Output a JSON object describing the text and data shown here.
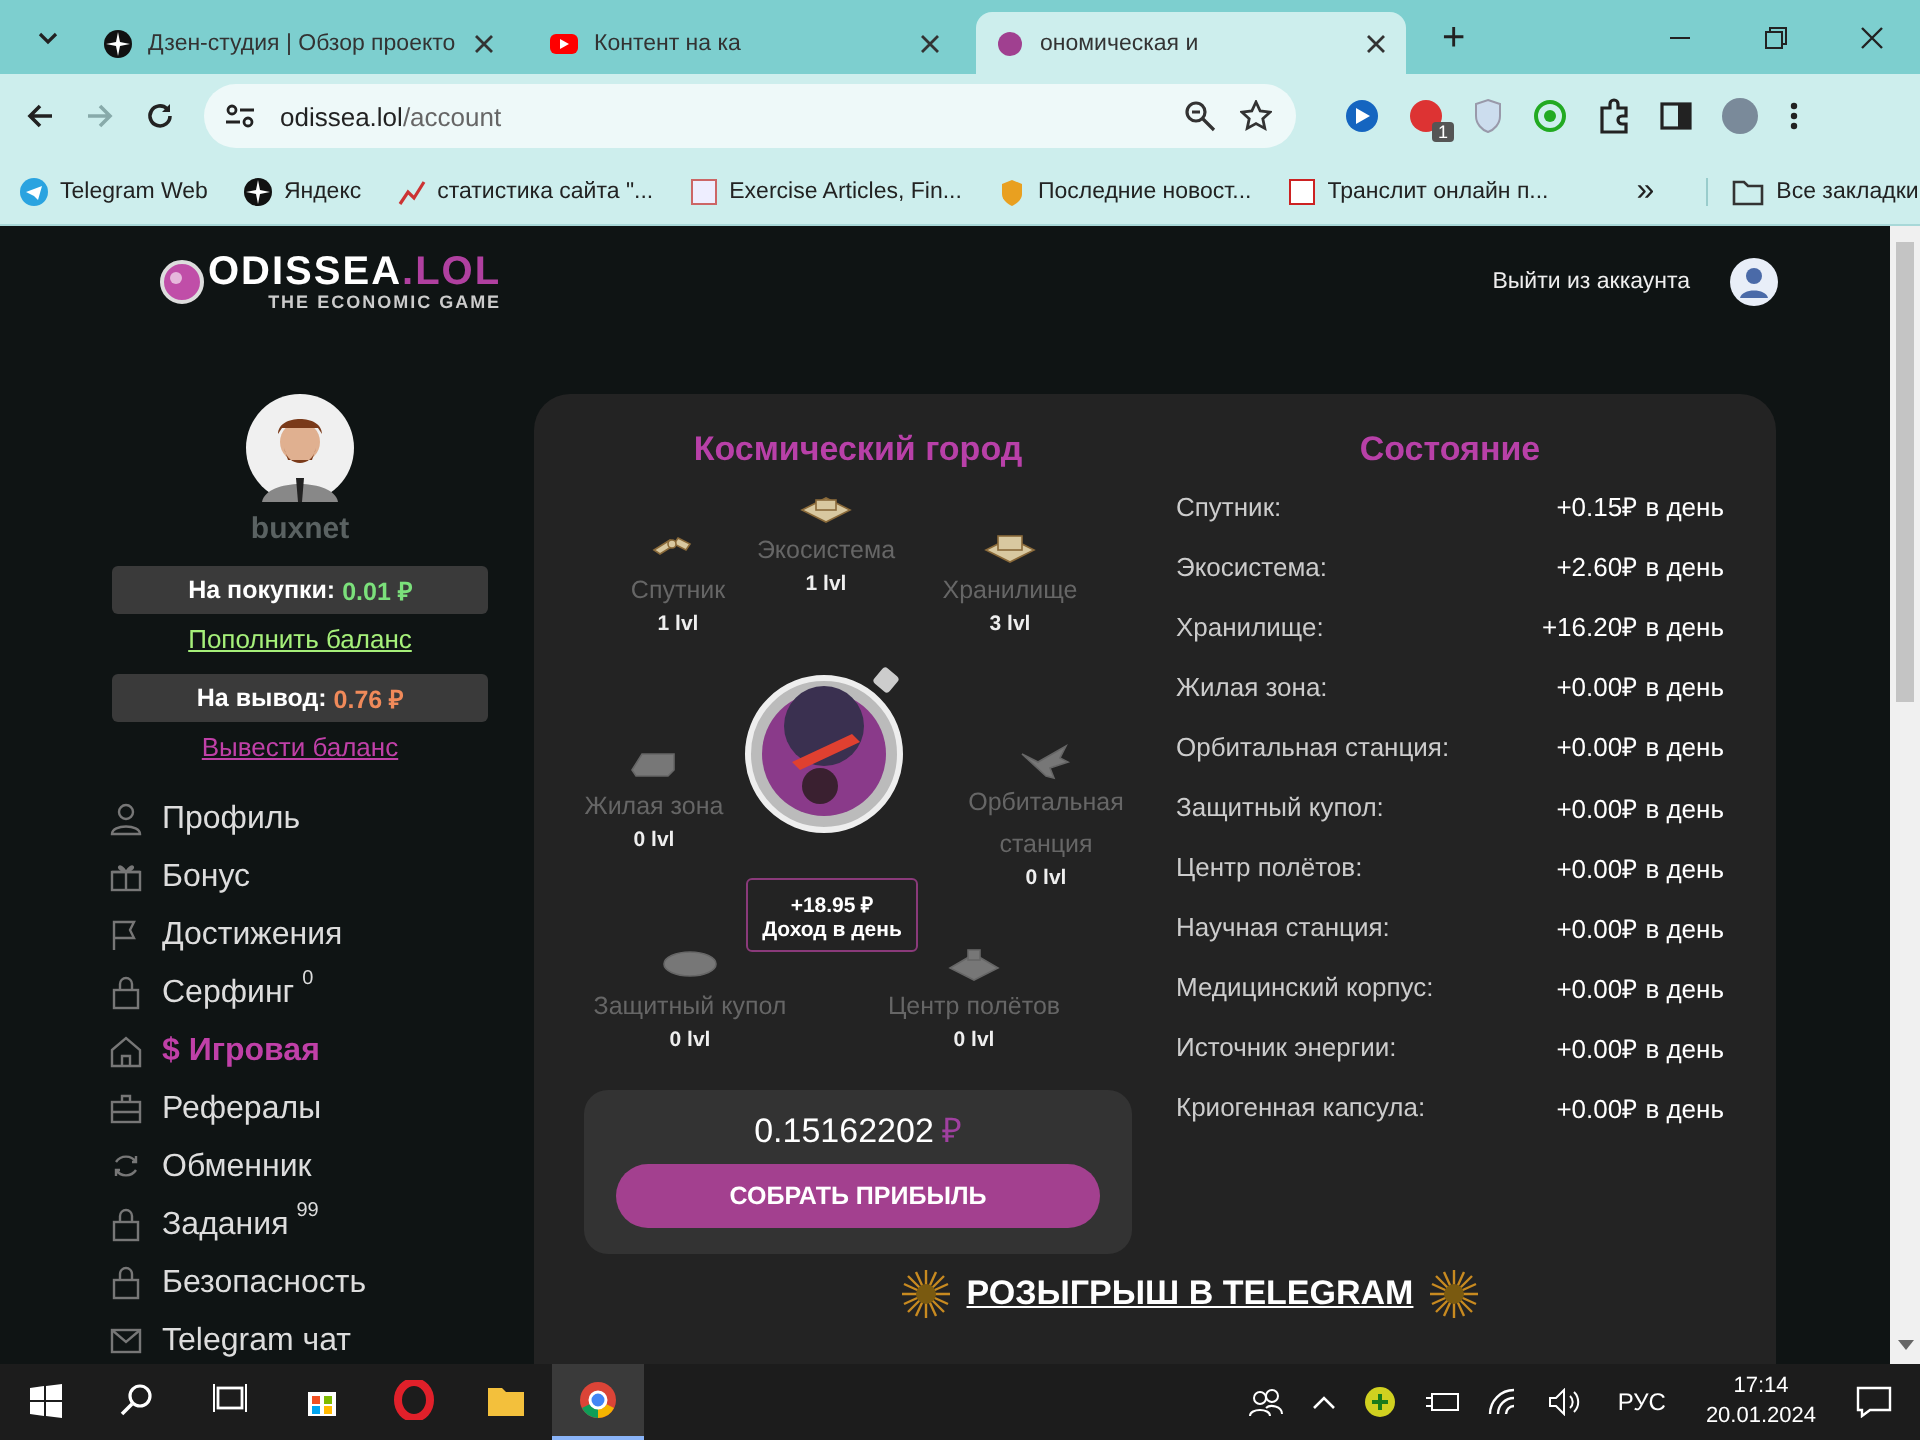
{
  "browser": {
    "tabs": [
      {
        "title": "Дзен-студия | Обзор проекто",
        "selected": false
      },
      {
        "title": "Контент на ка",
        "selected": false
      },
      {
        "title": "ономическая и",
        "selected": true
      }
    ],
    "new_tab": "+",
    "url": {
      "host": "odissea.lol",
      "path": "/account"
    },
    "extension_badge": "1",
    "bookmarks": [
      {
        "title": "Telegram Web"
      },
      {
        "title": "Яндекс"
      },
      {
        "title": "статистика сайта \"..."
      },
      {
        "title": "Exercise Articles, Fin..."
      },
      {
        "title": "Последние новост..."
      },
      {
        "title": "Транслит онлайн п..."
      }
    ],
    "more_bookmarks": "»",
    "all_bookmarks": "Все закладки"
  },
  "page": {
    "logo": {
      "name": "ODISSEA",
      "tld": ".LOL",
      "tagline": "THE ECONOMIC GAME"
    },
    "logout": "Выйти из аккаунта",
    "user": {
      "name": "buxnet"
    },
    "balances": [
      {
        "label": "На покупки:",
        "amount": "0.01 ₽",
        "color": "#7be07b",
        "link": "Пополнить баланс",
        "kind": "deposit"
      },
      {
        "label": "На вывод:",
        "amount": "0.76 ₽",
        "color": "#f08a5a",
        "link": "Вывести баланс",
        "kind": "withdraw"
      }
    ],
    "nav": [
      {
        "label": "Профиль",
        "selected": false
      },
      {
        "label": "Бонус",
        "selected": false
      },
      {
        "label": "Достижения",
        "selected": false
      },
      {
        "label": "Серфинг",
        "badge": "0",
        "selected": false
      },
      {
        "label": "$ Игровая",
        "selected": true
      },
      {
        "label": "Рефералы",
        "selected": false
      },
      {
        "label": "Обменник",
        "selected": false
      },
      {
        "label": "Задания",
        "badge": "99",
        "selected": false
      },
      {
        "label": "Безопасность",
        "selected": false
      },
      {
        "label": "Telegram чат",
        "selected": false
      }
    ],
    "city": {
      "title": "Космический город",
      "buildings": [
        {
          "name": "Спутник",
          "level": "1 lvl",
          "built": true
        },
        {
          "name": "Экосистема",
          "level": "1 lvl",
          "built": true
        },
        {
          "name": "Хранилище",
          "level": "3 lvl",
          "built": true
        },
        {
          "name": "Жилая зона",
          "level": "0 lvl",
          "built": false
        },
        {
          "name": "Орбитальная станция",
          "level": "0 lvl",
          "built": false
        },
        {
          "name": "Защитный купол",
          "level": "0 lvl",
          "built": false
        },
        {
          "name": "Центр полётов",
          "level": "0 lvl",
          "built": false
        }
      ],
      "income": {
        "amount": "+18.95 ₽",
        "label": "Доход в день"
      },
      "counter": {
        "value": "0.15162202",
        "currency": "₽"
      },
      "collect_button": "СОБРАТЬ ПРИБЫЛЬ"
    },
    "state": {
      "title": "Состояние",
      "rows": [
        {
          "name": "Спутник:",
          "value": "+0.15₽ в день"
        },
        {
          "name": "Экосистема:",
          "value": "+2.60₽ в день"
        },
        {
          "name": "Хранилище:",
          "value": "+16.20₽ в день"
        },
        {
          "name": "Жилая зона:",
          "value": "+0.00₽ в день"
        },
        {
          "name": "Орбитальная станция:",
          "value": "+0.00₽ в день"
        },
        {
          "name": "Защитный купол:",
          "value": "+0.00₽ в день"
        },
        {
          "name": "Центр полётов:",
          "value": "+0.00₽ в день"
        },
        {
          "name": "Научная станция:",
          "value": "+0.00₽ в день"
        },
        {
          "name": "Медицинский корпус:",
          "value": "+0.00₽ в день"
        },
        {
          "name": "Источник энергии:",
          "value": "+0.00₽ в день"
        },
        {
          "name": "Криогенная капсула:",
          "value": "+0.00₽ в день"
        }
      ]
    },
    "telegram_banner": "РОЗЫГРЫШ В TELEGRAM"
  },
  "taskbar": {
    "apps": [
      {
        "active": false
      },
      {
        "active": false
      },
      {
        "active": false
      },
      {
        "active": false
      },
      {
        "active": false
      },
      {
        "active": false
      },
      {
        "active": true
      }
    ],
    "language": "РУС",
    "time": "17:14",
    "date": "20.01.2024"
  }
}
